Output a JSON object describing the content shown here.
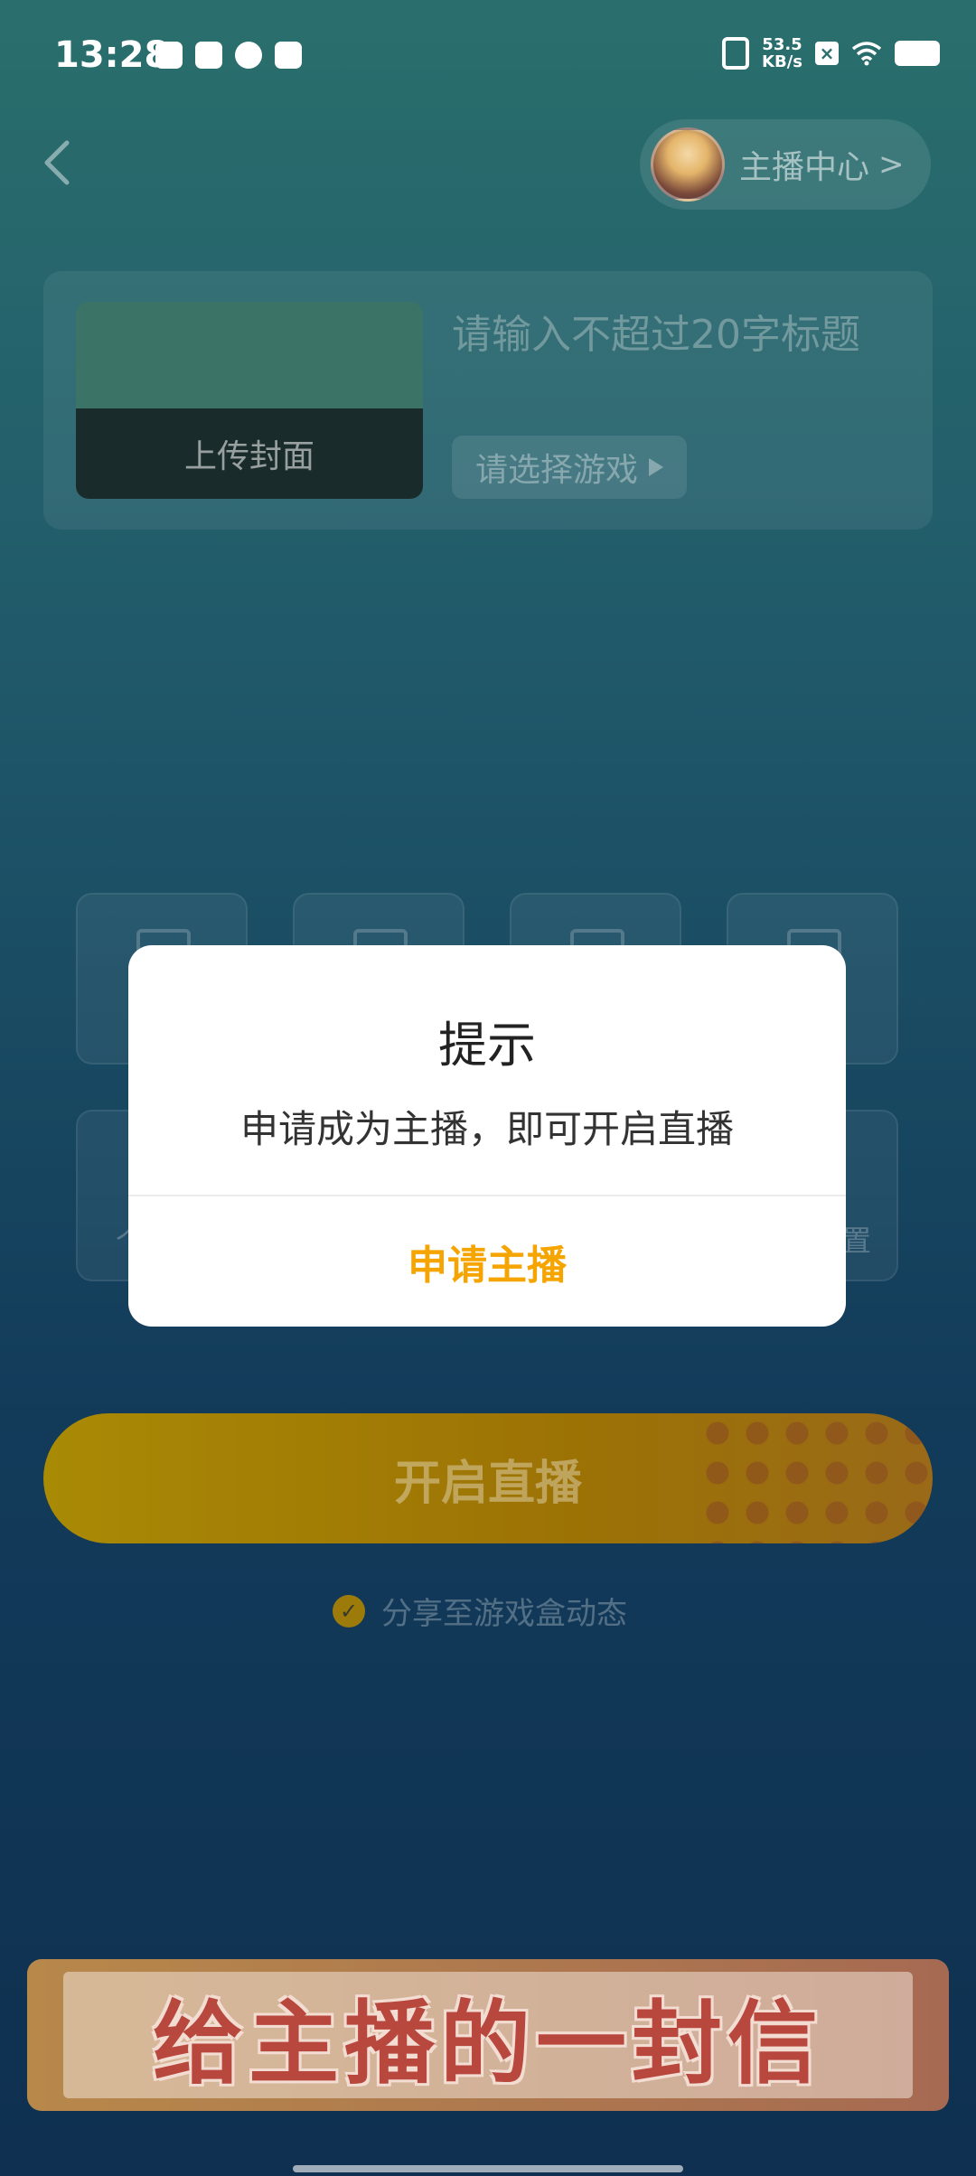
{
  "status_bar": {
    "time": "13:28",
    "net_speed_value": "53.5",
    "net_speed_unit": "KB/s"
  },
  "nav": {
    "anchor_center_label": "主播中心",
    "chevron": ">"
  },
  "cover_card": {
    "upload_label": "上传封面",
    "title_placeholder": "请输入不超过20字标题",
    "game_select_label": "请选择游戏"
  },
  "tiles_partial_text": {
    "left": "个",
    "right": "置"
  },
  "go_live_label": "开启直播",
  "share_label": "分享至游戏盒动态",
  "banner_text": "给主播的一封信",
  "dialog": {
    "title": "提示",
    "message": "申请成为主播，即可开启直播",
    "button_label": "申请主播",
    "button_color": "#f5a400"
  }
}
